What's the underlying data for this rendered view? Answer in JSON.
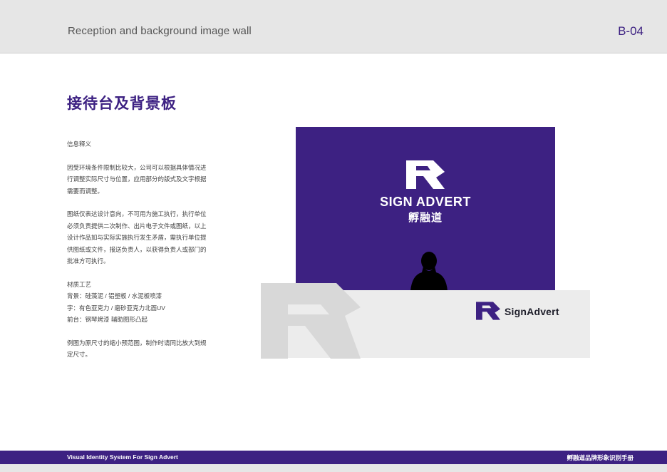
{
  "header": {
    "title": "Reception and background image wall",
    "page_code": "B-04"
  },
  "section": {
    "title": "接待台及背景板"
  },
  "description": {
    "label": "信息释义",
    "para1": "因受环境条件限制比较大，公司可以根据具体情况进行调整实际尺寸与位置，应用部分的版式及文字根据需要而调整。",
    "para2": "图纸仅表达设计意向，不可用为施工执行，执行单位必须负责提供二次制作、出片电子文件或图纸，以上设计作品如与实际实施执行发生矛盾，需执行单位提供图纸或文件，报送负责人，以获得负责人或部门的批准方可执行。",
    "materials_label": "材质工艺",
    "materials": [
      "背景：硅藻泥 / 铝塑板 / 水泥板喷漆",
      "字：有色亚克力 / 磨砂亚克力北面UV",
      "前台：钢琴烤漆 辅助图形凸起"
    ],
    "note": "例图为原尺寸的缩小预范图，制作时请同比放大到规定尺寸。"
  },
  "mockup": {
    "wall_brand_en": "SIGN ADVERT",
    "wall_brand_cn": "孵融道",
    "desk_brand": "SignAdvert"
  },
  "footer": {
    "left": "Visual Identity System For Sign Advert",
    "right": "孵融道品牌形象识别手册"
  },
  "colors": {
    "brand_purple": "#3d2182",
    "header_gray": "#e6e6e6",
    "desk_gray": "#ececec"
  }
}
